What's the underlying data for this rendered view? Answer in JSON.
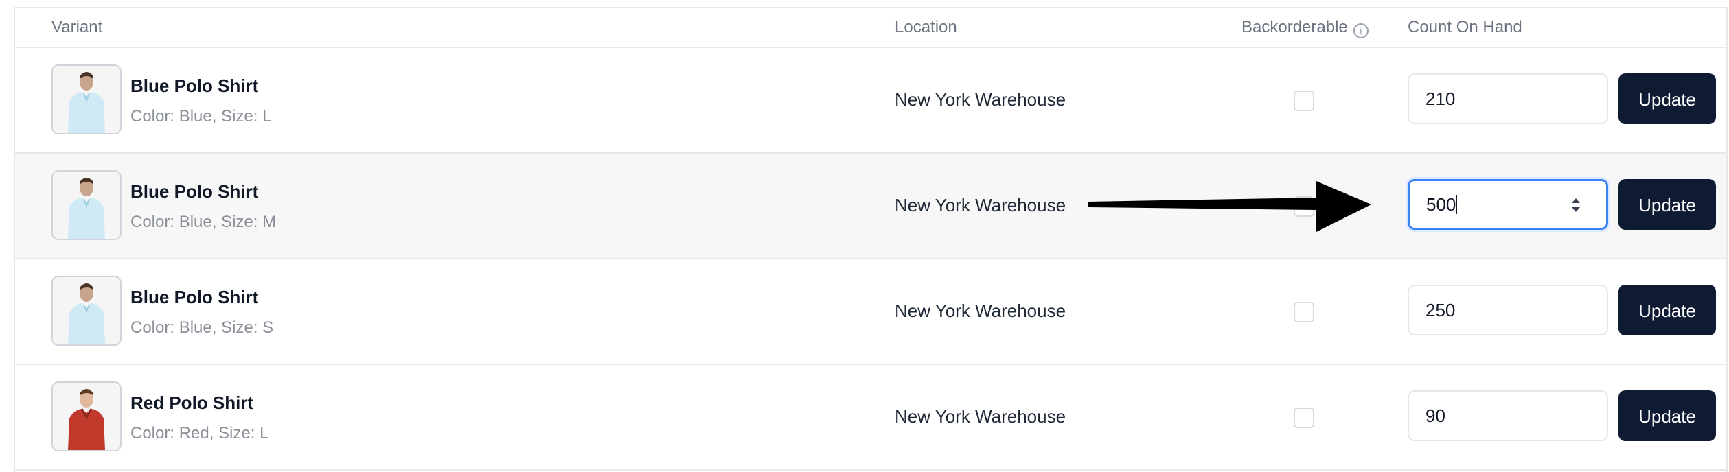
{
  "table": {
    "headers": {
      "variant": "Variant",
      "location": "Location",
      "backorderable": "Backorderable",
      "count_on_hand": "Count On Hand"
    },
    "rows": [
      {
        "name": "Blue Polo Shirt",
        "options": "Color: Blue, Size: L",
        "location": "New York Warehouse",
        "backorderable": false,
        "count": "210",
        "update_label": "Update",
        "shirt_color": "#cfe9f5"
      },
      {
        "name": "Blue Polo Shirt",
        "options": "Color: Blue, Size: M",
        "location": "New York Warehouse",
        "backorderable": false,
        "count": "500",
        "update_label": "Update",
        "shirt_color": "#cfe9f5",
        "focused": true
      },
      {
        "name": "Blue Polo Shirt",
        "options": "Color: Blue, Size: S",
        "location": "New York Warehouse",
        "backorderable": false,
        "count": "250",
        "update_label": "Update",
        "shirt_color": "#cfe9f5"
      },
      {
        "name": "Red Polo Shirt",
        "options": "Color: Red, Size: L",
        "location": "New York Warehouse",
        "backorderable": false,
        "count": "90",
        "update_label": "Update",
        "shirt_color": "#c0392b"
      }
    ]
  },
  "annotation": {
    "icon": "arrow-right-icon",
    "color": "#000000"
  },
  "colors": {
    "button_bg": "#0f1b33",
    "focus_ring": "#3b82f6"
  }
}
